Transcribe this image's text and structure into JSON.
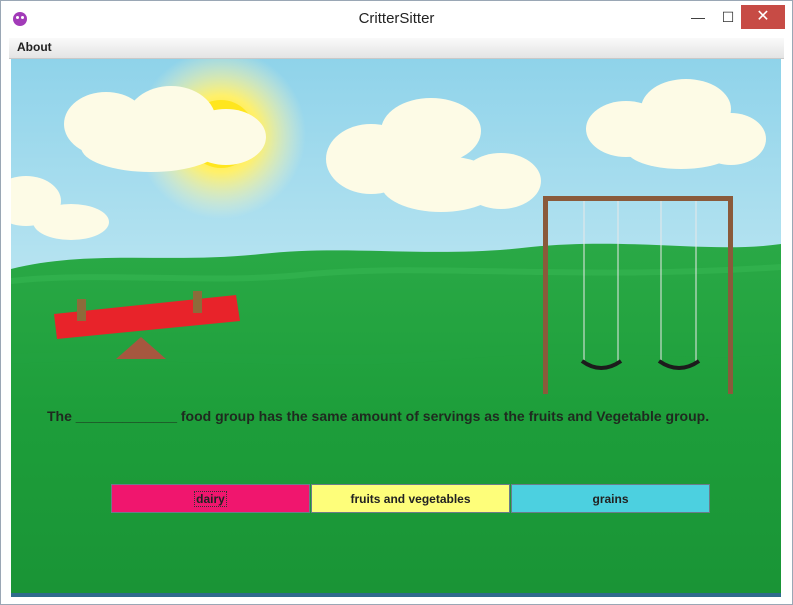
{
  "window": {
    "title": "CritterSitter",
    "controls": {
      "minimize": "—",
      "maximize": "☐",
      "close": "✕"
    }
  },
  "menubar": {
    "items": [
      "About"
    ]
  },
  "scene": {
    "icons": [
      "sun-icon",
      "cloud-icon",
      "seesaw-icon",
      "swing-set-icon"
    ],
    "colors": {
      "sky": "#8fd3ea",
      "grass": "#1d9e3a",
      "seesaw": "#e8232a",
      "swing_frame": "#8a5a3b"
    }
  },
  "question": {
    "text": "The _____________ food group has the same amount of servings as the fruits and Vegetable group."
  },
  "answers": [
    {
      "label": "dairy",
      "color": "#f0166e",
      "focused": true
    },
    {
      "label": "fruits and vegetables",
      "color": "#fefe7a",
      "focused": false
    },
    {
      "label": "grains",
      "color": "#4cd0e0",
      "focused": false
    }
  ]
}
